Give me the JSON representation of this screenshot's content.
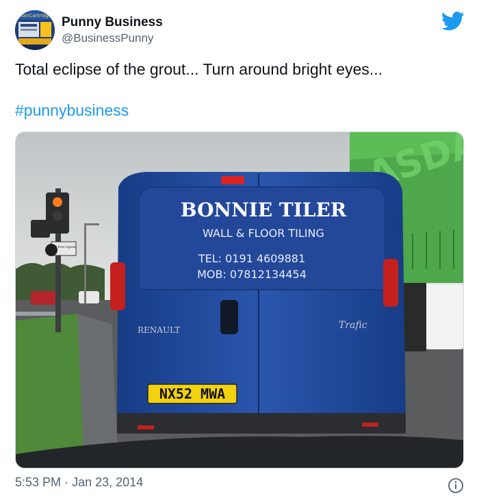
{
  "author": {
    "display_name": "Punny Business",
    "handle": "@BusinessPunny",
    "avatar_text": "AlanCartridge"
  },
  "tweet": {
    "text": "Total eclipse of the grout... Turn around bright eyes...",
    "hashtag": "#punnybusiness",
    "time": "5:53 PM",
    "separator": "·",
    "date": "Jan 23, 2014"
  },
  "photo": {
    "van_title": "BONNIE TILER",
    "van_subtitle": "WALL & FLOOR TILING",
    "van_tel": "TEL: 0191 4609881",
    "van_mob": "MOB: 07812134454",
    "van_make": "RENAULT",
    "van_model": "Trafic",
    "number_plate": "NX52 MWA",
    "truck_text": "ASDA",
    "sign_text": "Part time signals"
  },
  "colors": {
    "link": "#1d9bf0",
    "van_blue": "#1f4b9e",
    "truck_green": "#4ea84b",
    "plate_yellow": "#f2d20f"
  },
  "icons": {
    "brand": "twitter-bird-icon",
    "info": "info-icon"
  }
}
